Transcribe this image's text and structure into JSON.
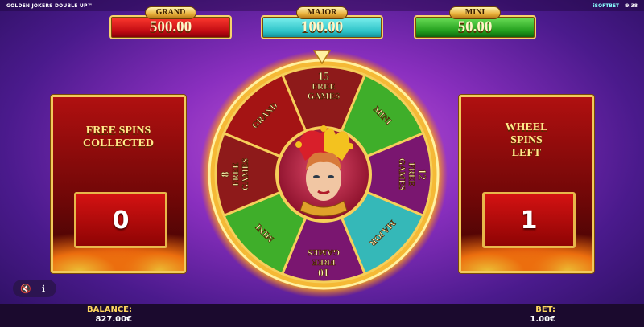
{
  "game": {
    "title": "GOLDEN JOKERS DOUBLE UP™",
    "brand": "iSOFTBET",
    "clock": "9:38"
  },
  "jackpots": [
    {
      "label": "GRAND",
      "value": "500.00",
      "color": "#c00a12"
    },
    {
      "label": "MAJOR",
      "value": "100.00",
      "color": "#2cc2c7"
    },
    {
      "label": "MINI",
      "value": "50.00",
      "color": "#1f9b1a"
    }
  ],
  "left_panel": {
    "title": "FREE SPINS\nCOLLECTED",
    "value": "0"
  },
  "right_panel": {
    "title": "WHEEL\nSPINS\nLEFT",
    "value": "1"
  },
  "wheel": {
    "segments": [
      {
        "lines": [
          "15",
          "FREE",
          "GAMES"
        ],
        "color": "#8e1a1a"
      },
      {
        "lines": [
          "MINI"
        ],
        "color": "#3fae2a"
      },
      {
        "lines": [
          "12",
          "FREE",
          "GAMES"
        ],
        "color": "#7a1670"
      },
      {
        "lines": [
          "MAJOR"
        ],
        "color": "#35b8b8"
      },
      {
        "lines": [
          "10",
          "FREE",
          "GAMES"
        ],
        "color": "#7a1670"
      },
      {
        "lines": [
          "MINI"
        ],
        "color": "#3fae2a"
      },
      {
        "lines": [
          "8",
          "FREE",
          "GAMES"
        ],
        "color": "#8e1a1a"
      },
      {
        "lines": [
          "GRAND"
        ],
        "color": "#a41414"
      }
    ],
    "center_icon": "jester-face-icon"
  },
  "controls": {
    "sound_icon": "speaker-mute-icon",
    "info_icon": "info-icon",
    "sound_glyph": "🔇",
    "info_glyph": "ℹ"
  },
  "footer": {
    "balance_label": "BALANCE:",
    "balance_value": "827.00€",
    "bet_label": "BET:",
    "bet_value": "1.00€"
  }
}
